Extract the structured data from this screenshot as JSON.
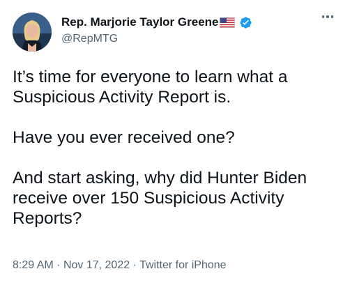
{
  "author": {
    "display_name": "Rep. Marjorie Taylor Greene",
    "flag_icon": "us-flag-icon",
    "verified_icon": "verified-badge-icon",
    "verified_color": "#1d9bf0",
    "handle": "@RepMTG"
  },
  "tweet": {
    "paragraphs": [
      "It’s time for everyone to learn what a Suspicious Activity Report is.",
      "Have you ever received one?",
      "And start asking, why did Hunter Biden receive over 150 Suspicious Activity Reports?"
    ]
  },
  "meta": {
    "time": "8:29 AM",
    "date": "Nov 17, 2022",
    "source": "Twitter for iPhone",
    "separator": "·"
  },
  "more_icon": "more-options-icon"
}
